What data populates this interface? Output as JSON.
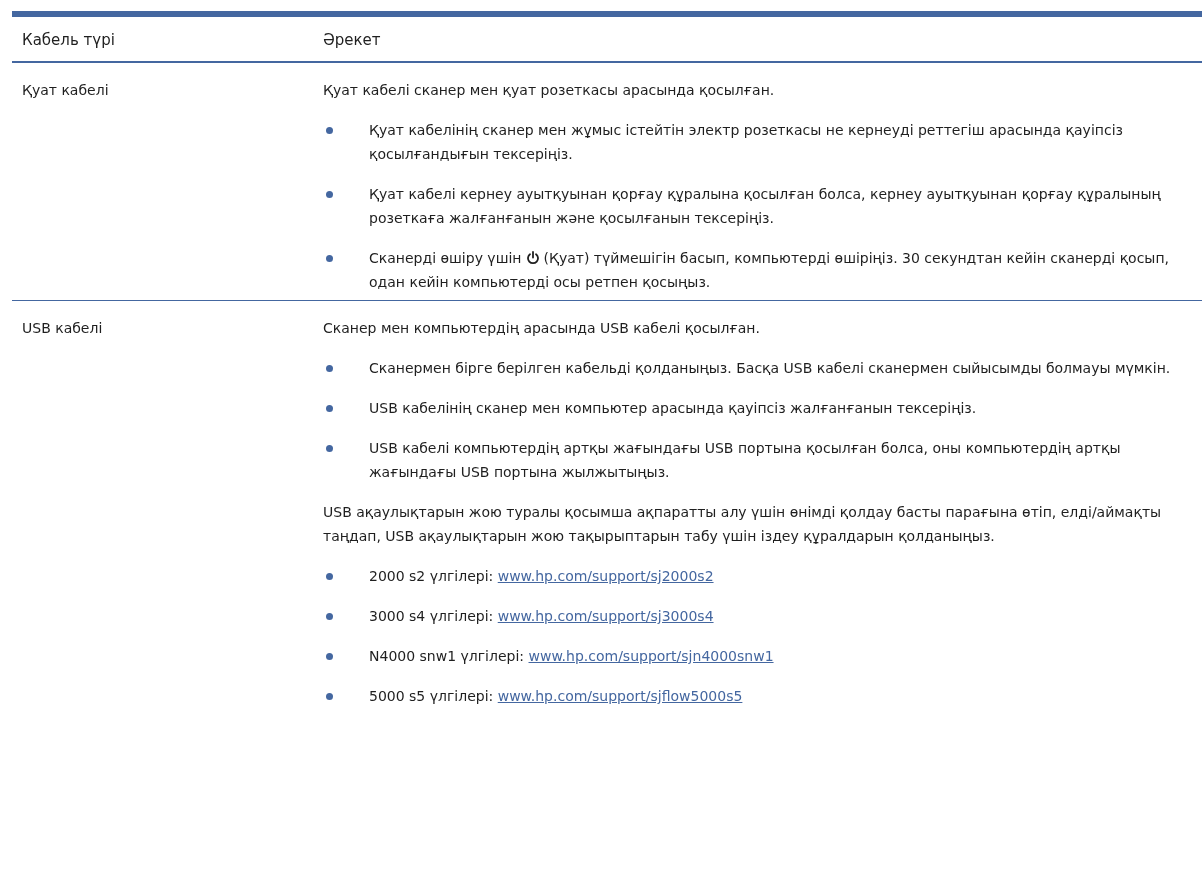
{
  "table": {
    "columns": [
      "Кабель түрі",
      "Әрекет"
    ],
    "rows": [
      {
        "cable": "Қуат кабелі",
        "blocks": [
          {
            "kind": "para",
            "text": "Қуат кабелі сканер мен қуат розеткасы арасында қосылған."
          },
          {
            "kind": "bullet",
            "text": "Қуат кабелінің сканер мен жұмыс істейтін электр розеткасы не кернеуді реттегіш арасында қауіпсіз қосылғандығын тексеріңіз."
          },
          {
            "kind": "bullet",
            "text": "Қуат кабелі кернеу ауытқуынан қорғау құралына қосылған болса, кернеу ауытқуынан қорғау құралының розеткаға жалғанғанын және қосылғанын тексеріңіз."
          },
          {
            "kind": "icon_bullet",
            "before": "Сканерді өшіру үшін",
            "after": "(Қуат) түймешігін басып, компьютерді өшіріңіз. 30 секундтан кейін сканерді қосып, одан кейін компьютерді осы ретпен қосыңыз."
          }
        ]
      },
      {
        "cable": "USB кабелі",
        "blocks": [
          {
            "kind": "para",
            "text": "Сканер мен компьютердің арасында USB кабелі қосылған."
          },
          {
            "kind": "bullet",
            "text": "Сканермен бірге берілген кабельді қолданыңыз. Басқа USB кабелі сканермен сыйысымды болмауы мүмкін."
          },
          {
            "kind": "bullet",
            "text": "USB кабелінің сканер мен компьютер арасында қауіпсіз жалғанғанын тексеріңіз."
          },
          {
            "kind": "bullet",
            "text": "USB кабелі компьютердің артқы жағындағы USB портына қосылған болса, оны компьютердің артқы жағындағы USB портына жылжытыңыз."
          },
          {
            "kind": "para",
            "text": "USB ақаулықтарын жою туралы қосымша ақпаратты алу үшін өнімді қолдау басты парағына өтіп, елді/аймақты таңдап, USB ақаулықтарын жою тақырыптарын табу үшін іздеу құралдарын қолданыңыз."
          },
          {
            "kind": "link_bullet",
            "text": "2000 s2 үлгілері:",
            "link": "www.hp.com/support/sj2000s2"
          },
          {
            "kind": "link_bullet",
            "text": "3000 s4 үлгілері:",
            "link": "www.hp.com/support/sj3000s4"
          },
          {
            "kind": "link_bullet",
            "text": "N4000 snw1 үлгілері:",
            "link": "www.hp.com/support/sjn4000snw1"
          },
          {
            "kind": "link_bullet",
            "text": "5000 s5 үлгілері:",
            "link": "www.hp.com/support/sjflow5000s5"
          }
        ]
      }
    ]
  }
}
